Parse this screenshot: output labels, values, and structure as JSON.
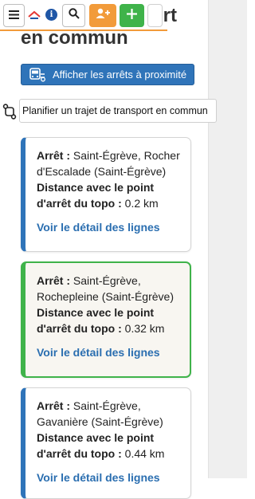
{
  "page": {
    "title_line1": "rt",
    "title_line2": "en commun"
  },
  "toolbar": {
    "menu_icon": "hamburger-icon",
    "info_label": "i",
    "search_icon": "search-icon",
    "add_user_icon": "add-user-icon",
    "add_icon": "plus-icon",
    "accent": "#f29b3a",
    "green": "#3fb34a"
  },
  "actions": {
    "nearby_label": "Afficher les arrêts à proximité",
    "plan_label": "Planifier un trajet de transport en commun"
  },
  "stops": [
    {
      "label_stop": "Arrêt :",
      "name": "Saint-Égrève, Rocher d'Escalade (Saint-Égrève)",
      "label_distance": "Distance avec le point d'arrêt du topo :",
      "distance": "0.2 km",
      "link": "Voir le détail des lignes"
    },
    {
      "label_stop": "Arrêt :",
      "name": "Saint-Égrève, Rochepleine (Saint-Égrève)",
      "label_distance": "Distance avec le point d'arrêt du topo :",
      "distance": "0.32 km",
      "link": "Voir le détail des lignes"
    },
    {
      "label_stop": "Arrêt :",
      "name": "Saint-Égrève, Gavanière (Saint-Égrève)",
      "label_distance": "Distance avec le point d'arrêt du topo :",
      "distance": "0.44 km",
      "link": "Voir le détail des lignes"
    }
  ]
}
